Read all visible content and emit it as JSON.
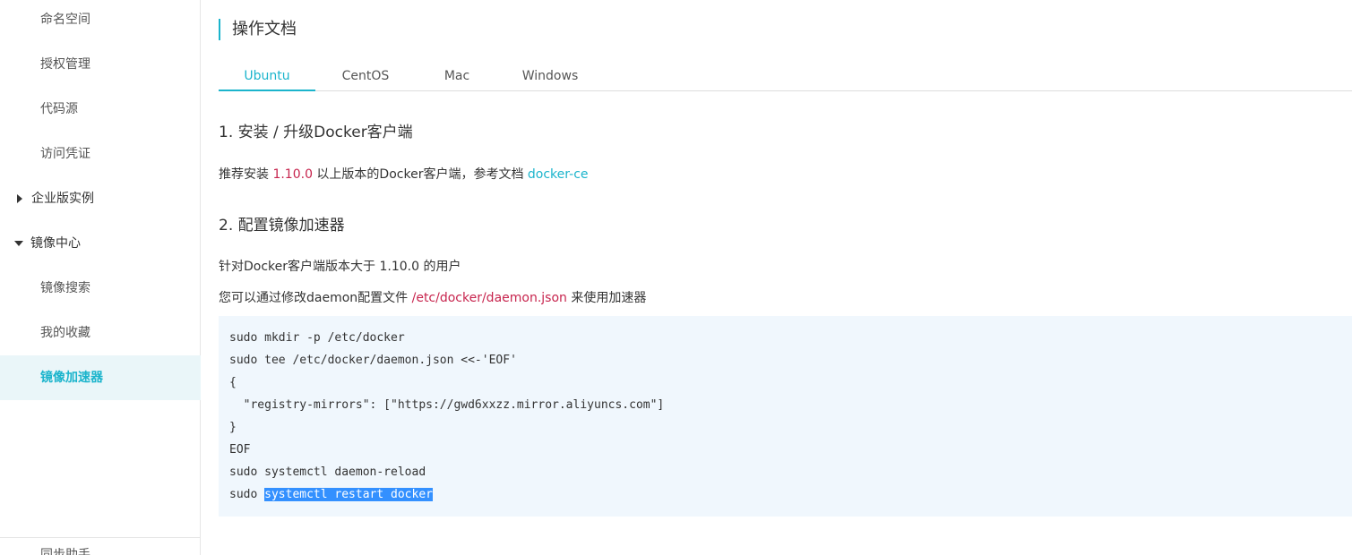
{
  "sidebar": {
    "items": [
      {
        "label": "命名空间"
      },
      {
        "label": "授权管理"
      },
      {
        "label": "代码源"
      },
      {
        "label": "访问凭证"
      },
      {
        "label": "企业版实例"
      },
      {
        "label": "镜像中心"
      },
      {
        "label": "镜像搜索"
      },
      {
        "label": "我的收藏"
      },
      {
        "label": "镜像加速器"
      }
    ],
    "cut_label": "同步助手"
  },
  "main": {
    "title": "操作文档",
    "tabs": [
      {
        "label": "Ubuntu"
      },
      {
        "label": "CentOS"
      },
      {
        "label": "Mac"
      },
      {
        "label": "Windows"
      }
    ],
    "active_tab": "Ubuntu",
    "section1": {
      "heading": "1. 安装 / 升级Docker客户端",
      "text_before": "推荐安装 ",
      "version": "1.10.0",
      "text_middle": " 以上版本的Docker客户端，参考文档 ",
      "link": "docker-ce"
    },
    "section2": {
      "heading": "2. 配置镜像加速器",
      "line1": "针对Docker客户端版本大于 1.10.0 的用户",
      "line2_before": "您可以通过修改daemon配置文件 ",
      "path": "/etc/docker/daemon.json",
      "line2_after": " 来使用加速器"
    },
    "code": {
      "lines": [
        "sudo mkdir -p /etc/docker",
        "sudo tee /etc/docker/daemon.json <<-'EOF'",
        "{",
        "  \"registry-mirrors\": [\"https://gwd6xxzz.mirror.aliyuncs.com\"]",
        "}",
        "EOF",
        "sudo systemctl daemon-reload"
      ],
      "last_prefix": "sudo ",
      "last_selected": "systemctl restart docker"
    }
  },
  "colors": {
    "accent": "#1bb4cc",
    "red": "#c7254e",
    "code_bg": "#f0f7fd",
    "selection": "#3390ff"
  }
}
